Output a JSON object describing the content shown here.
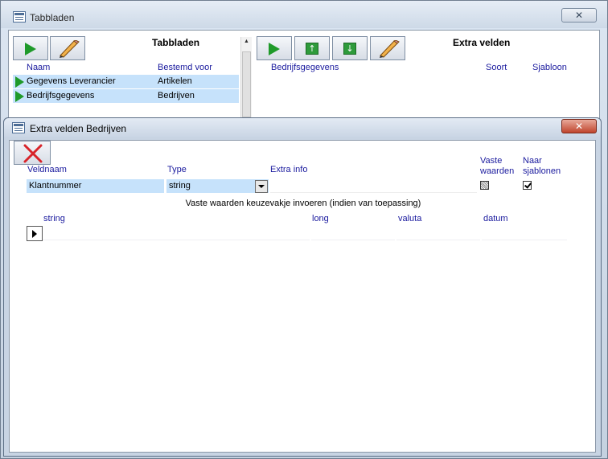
{
  "outer_window": {
    "title": "Tabbladen",
    "close_glyph": "✕",
    "left_panel": {
      "heading": "Tabbladen",
      "columns": [
        "Naam",
        "Bestemd voor"
      ],
      "rows": [
        {
          "naam": "Gegevens Leverancier",
          "bestemd_voor": "Artikelen"
        },
        {
          "naam": "Bedrijfsgegevens",
          "bestemd_voor": "Bedrijven"
        }
      ]
    },
    "right_panel": {
      "heading": "Extra velden",
      "columns": [
        "Bedrijfsgegevens",
        "Soort",
        "Sjabloon"
      ]
    }
  },
  "inner_window": {
    "title": "Extra velden Bedrijven",
    "close_glyph": "✕",
    "form": {
      "labels": {
        "veldnaam": "Veldnaam",
        "type": "Type",
        "extra_info": "Extra info",
        "vaste_waarden_1": "Vaste",
        "vaste_waarden_2": "waarden",
        "naar_sjablonen_1": "Naar",
        "naar_sjablonen_2": "sjablonen"
      },
      "values": {
        "veldnaam": "Klantnummer",
        "type": "string",
        "extra_info": "",
        "vaste_waarden_checked": "indeterminate",
        "naar_sjablonen_checked": true
      }
    },
    "subform": {
      "caption": "Vaste waarden keuzevakje invoeren (indien van toepassing)",
      "columns": [
        "string",
        "long",
        "valuta",
        "datum"
      ]
    }
  },
  "colors": {
    "row_highlight": "#c6e2fb",
    "header_text": "#1a1a9e",
    "play_green": "#1f9a2a",
    "delete_red": "#d8242a"
  }
}
